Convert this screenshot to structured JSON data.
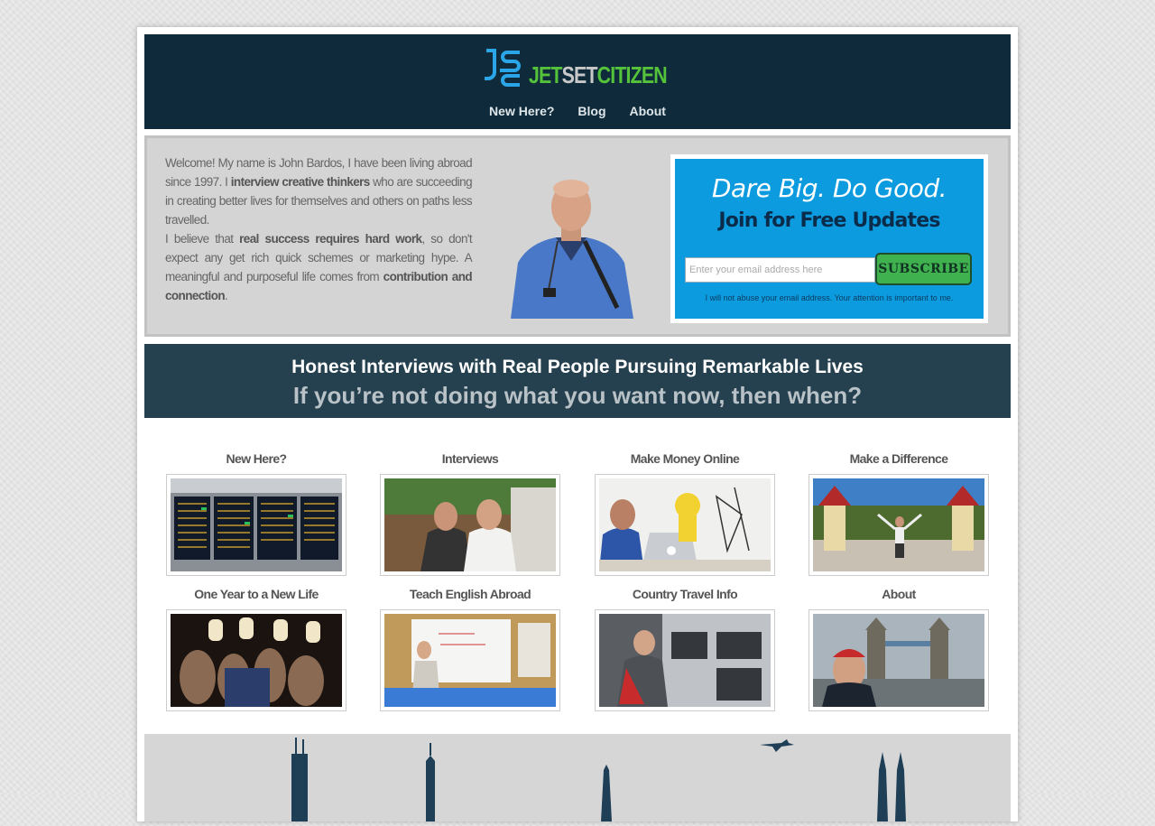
{
  "site": {
    "logo_text_jet": "JET",
    "logo_text_set": "SET",
    "logo_text_citizen": "CITIZEN",
    "colors": {
      "header": "#0f2b3b",
      "accent_green": "#55c23b",
      "optin_blue": "#0d9be0",
      "banner": "#25404f"
    }
  },
  "nav": [
    {
      "label": "New Here?"
    },
    {
      "label": "Blog"
    },
    {
      "label": "About"
    }
  ],
  "intro": {
    "p1_a": "Welcome! My name is John Bardos, I have been living abroad since 1997. I ",
    "p1_b": "interview creative thinkers",
    "p1_c": " who are succeeding in creating better lives for themselves and others on paths less travelled.",
    "p2_a": "I believe that ",
    "p2_b": "real success requires hard work",
    "p2_c": ", so don't expect any get rich quick schemes or marketing hype. A meaningful and purposeful life comes from ",
    "p2_d": "contribution and connection",
    "p2_e": "."
  },
  "optin": {
    "headline": "Dare Big. Do Good.",
    "subheadline": "Join for Free Updates",
    "email_placeholder": "Enter your email address here",
    "button_label": "SUBSCRIBE",
    "note": "I will not abuse your email address. Your attention is important to me."
  },
  "banner": {
    "line1": "Honest Interviews with Real People Pursuing Remarkable Lives",
    "line2": "If you’re not doing what you want now, then when?"
  },
  "cards": [
    {
      "title": "New Here?"
    },
    {
      "title": "Interviews"
    },
    {
      "title": "Make Money Online"
    },
    {
      "title": "Make a Difference"
    },
    {
      "title": "One Year to a New Life"
    },
    {
      "title": "Teach English Abroad"
    },
    {
      "title": "Country Travel Info"
    },
    {
      "title": "About"
    }
  ]
}
